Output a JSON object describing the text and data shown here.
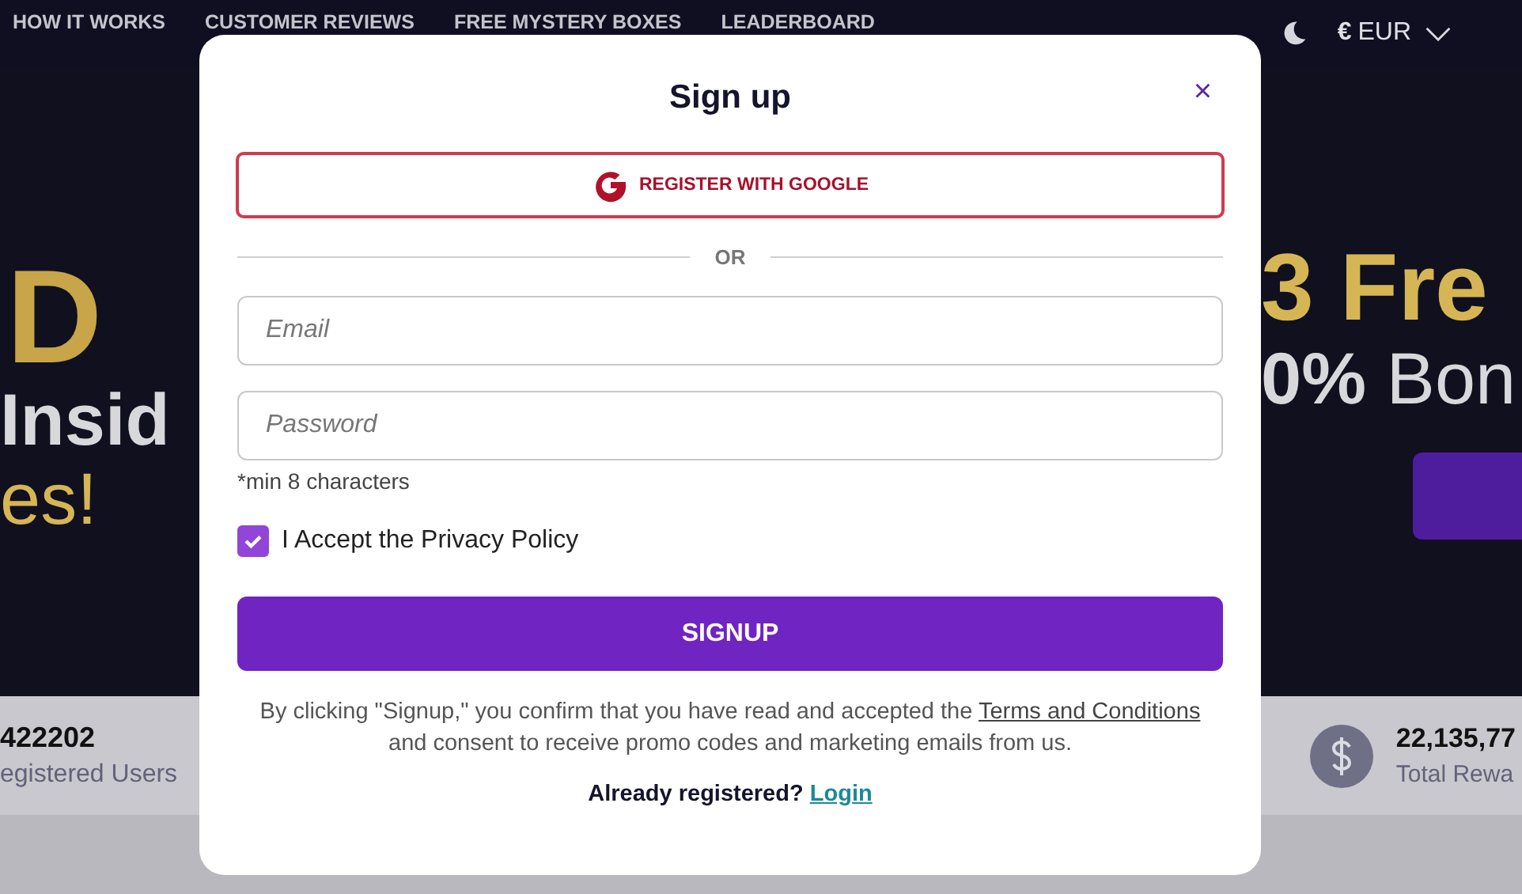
{
  "nav": {
    "links": [
      "HOW IT WORKS",
      "CUSTOMER REVIEWS",
      "FREE MYSTERY BOXES",
      "LEADERBOARD"
    ],
    "currency_symbol": "€",
    "currency": "EUR"
  },
  "hero": {
    "left_lines": [
      {
        "text": "D",
        "kind": "gold-big"
      },
      {
        "text": "Insid",
        "kind": "white"
      },
      {
        "text": "es!",
        "kind": "gold"
      }
    ],
    "right_lines": [
      {
        "text": "3 Fre",
        "kind": "gold-bold"
      },
      {
        "text": "**0%** Bon",
        "kind": "white"
      }
    ]
  },
  "stats": [
    {
      "value": "422202",
      "label": "egistered Users",
      "kind": "plain"
    },
    {
      "value": "22,135,77",
      "label": "Total Rewa",
      "kind": "dollar"
    }
  ],
  "modal": {
    "title": "Sign up",
    "close": "×",
    "google_button": "REGISTER WITH GOOGLE",
    "divider": "OR",
    "email": {
      "placeholder": "Email"
    },
    "password": {
      "placeholder": "Password"
    },
    "hint": "*min 8 characters",
    "accept": {
      "label": "I Accept the Privacy Policy",
      "checked": true
    },
    "submit": "SIGNUP",
    "terms": {
      "before": "By clicking \"Signup,\" you confirm that you have read and accepted the",
      "link": "Terms and Conditions",
      "after": "and consent to receive promo codes and marketing emails from us."
    },
    "login": {
      "prompt": "Already registered?",
      "link": "Login"
    }
  }
}
